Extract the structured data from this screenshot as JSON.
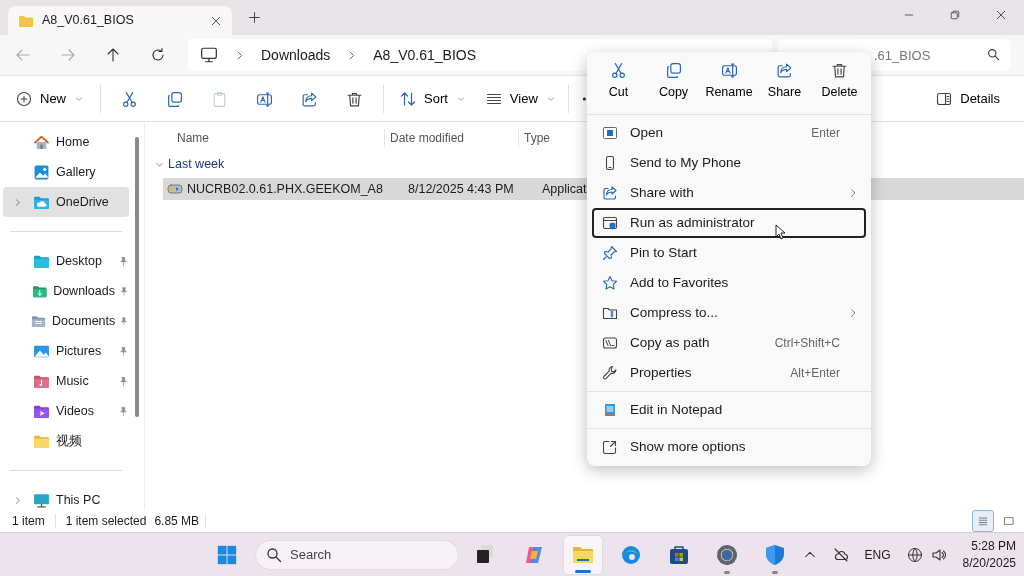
{
  "tab": {
    "title": "A8_V0.61_BIOS"
  },
  "breadcrumb": [
    "Downloads",
    "A8_V0.61_BIOS"
  ],
  "search": {
    "placeholder": ".61_BIOS"
  },
  "toolbar": {
    "new": "New",
    "sort": "Sort",
    "view": "View",
    "details": "Details",
    "actions": [
      {
        "kind": "cut",
        "disabled": false
      },
      {
        "kind": "copy",
        "disabled": false
      },
      {
        "kind": "paste",
        "disabled": true
      },
      {
        "kind": "rename",
        "disabled": false
      },
      {
        "kind": "share",
        "disabled": false
      },
      {
        "kind": "delete",
        "disabled": false
      }
    ]
  },
  "sidebar": {
    "sections": [
      [
        {
          "label": "Home",
          "kind": "home",
          "selected": false,
          "expandable": false,
          "pinned": false
        },
        {
          "label": "Gallery",
          "kind": "gallery",
          "selected": false,
          "expandable": false,
          "pinned": false
        },
        {
          "label": "OneDrive",
          "kind": "cloud",
          "selected": true,
          "expandable": true,
          "pinned": false
        }
      ],
      [
        {
          "label": "Desktop",
          "kind": "desktop",
          "selected": false,
          "expandable": false,
          "pinned": true
        },
        {
          "label": "Downloads",
          "kind": "downloads",
          "selected": false,
          "expandable": false,
          "pinned": true
        },
        {
          "label": "Documents",
          "kind": "documents",
          "selected": false,
          "expandable": false,
          "pinned": true
        },
        {
          "label": "Pictures",
          "kind": "pictures",
          "selected": false,
          "expandable": false,
          "pinned": true
        },
        {
          "label": "Music",
          "kind": "music",
          "selected": false,
          "expandable": false,
          "pinned": true
        },
        {
          "label": "Videos",
          "kind": "videos",
          "selected": false,
          "expandable": false,
          "pinned": true
        },
        {
          "label": "视频",
          "kind": "folder",
          "selected": false,
          "expandable": false,
          "pinned": false
        }
      ],
      [
        {
          "label": "This PC",
          "kind": "pc",
          "selected": false,
          "expandable": true,
          "pinned": false
        }
      ]
    ]
  },
  "columns": [
    "Name",
    "Date modified",
    "Type"
  ],
  "groups": [
    {
      "label": "Last week",
      "expanded": true,
      "rows": [
        {
          "name": "NUCRB02.0.61.PHX.GEEKOM_A8",
          "date": "8/12/2025 4:43 PM",
          "type": "Applicat",
          "selected": true
        }
      ]
    }
  ],
  "status_bar": {
    "count": "1 item",
    "selection": "1 item selected",
    "size": "6.85 MB",
    "view_modes": [
      {
        "kind": "details",
        "selected": true
      },
      {
        "kind": "tiles",
        "selected": false
      }
    ]
  },
  "context_menu": {
    "quick_actions": [
      {
        "label": "Cut",
        "kind": "cut"
      },
      {
        "label": "Copy",
        "kind": "copy"
      },
      {
        "label": "Rename",
        "kind": "rename"
      },
      {
        "label": "Share",
        "kind": "share"
      },
      {
        "label": "Delete",
        "kind": "delete"
      }
    ],
    "groups": [
      [
        {
          "label": "Open",
          "kind": "open",
          "shortcut": "Enter",
          "submenu": false,
          "focused": false
        },
        {
          "label": "Send to My Phone",
          "kind": "phone",
          "submenu": false,
          "focused": false
        },
        {
          "label": "Share with",
          "kind": "share",
          "submenu": true,
          "focused": false
        },
        {
          "label": "Run as administrator",
          "kind": "admin",
          "submenu": false,
          "focused": true
        },
        {
          "label": "Pin to Start",
          "kind": "pin",
          "submenu": false,
          "focused": false
        },
        {
          "label": "Add to Favorites",
          "kind": "star",
          "submenu": false,
          "focused": false
        },
        {
          "label": "Compress to...",
          "kind": "compress",
          "submenu": true,
          "focused": false
        },
        {
          "label": "Copy as path",
          "kind": "path",
          "shortcut": "Ctrl+Shift+C",
          "submenu": false,
          "focused": false
        },
        {
          "label": "Properties",
          "kind": "wrench",
          "shortcut": "Alt+Enter",
          "submenu": false,
          "focused": false
        }
      ],
      [
        {
          "label": "Edit in Notepad",
          "kind": "notepad",
          "submenu": false,
          "focused": false
        }
      ],
      [
        {
          "label": "Show more options",
          "kind": "more",
          "submenu": false,
          "focused": false
        }
      ]
    ]
  },
  "taskbar": {
    "search": {
      "placeholder": "Search"
    },
    "apps": [
      {
        "kind": "taskview",
        "active": false,
        "running": false
      },
      {
        "kind": "copilot",
        "active": false,
        "running": false
      },
      {
        "kind": "explorer",
        "active": true,
        "running": true
      },
      {
        "kind": "browser",
        "active": false,
        "running": false
      },
      {
        "kind": "store",
        "active": false,
        "running": false
      },
      {
        "kind": "settings",
        "active": false,
        "running": true
      },
      {
        "kind": "shield",
        "active": false,
        "running": true
      }
    ],
    "language": "ENG",
    "time": "5:28 PM",
    "date": "8/20/2025"
  }
}
